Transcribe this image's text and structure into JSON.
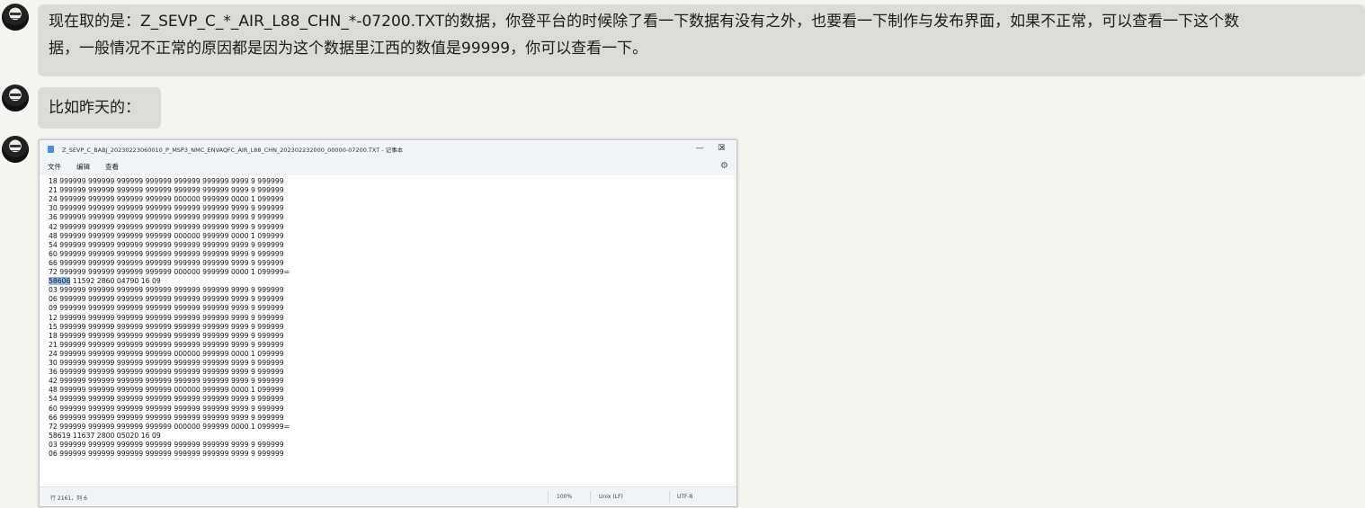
{
  "messages": [
    {
      "lines": [
        "现在取的是：Z_SEVP_C_*_AIR_L88_CHN_*-07200.TXT的数据，你登平台的时候除了看一下数据有没有之外，也要看一下制作与发布界面，如果不正常，可以查看一下这个数",
        "据，一般情况不正常的原因都是因为这个数据里江西的数值是99999，你可以查看一下。"
      ]
    },
    {
      "text": "比如昨天的："
    }
  ],
  "notepad": {
    "title": "Z_SEVP_C_BABJ_20230223060010_P_MSP3_NMC_ENVAQFC_AIR_L88_CHN_202302232000_00000-07200.TXT - 记事本",
    "minimize": "—",
    "maximize": "☐",
    "close": "✕",
    "menu": [
      "文件",
      "编辑",
      "查看"
    ],
    "settings_icon": "gear-icon",
    "lines": [
      "18 999999 999999 999999 999999 999999 999999 9999 9 999999",
      "21 999999 999999 999999 999999 999999 999999 9999 9 999999",
      "24 999999 999999 999999 999999 000000 999999 0000 1 099999",
      "30 999999 999999 999999 999999 999999 999999 9999 9 999999",
      "36 999999 999999 999999 999999 999999 999999 9999 9 999999",
      "42 999999 999999 999999 999999 999999 999999 9999 9 999999",
      "48 999999 999999 999999 999999 000000 999999 0000 1 099999",
      "54 999999 999999 999999 999999 999999 999999 9999 9 999999",
      "60 999999 999999 999999 999999 999999 999999 9999 9 999999",
      "66 999999 999999 999999 999999 999999 999999 9999 9 999999",
      "72 999999 999999 999999 999999 000000 999999 0000 1 099999=",
      "58606 11592 2860 04790 16 09",
      "03 999999 999999 999999 999999 999999 999999 9999 9 999999",
      "06 999999 999999 999999 999999 999999 999999 9999 9 999999",
      "09 999999 999999 999999 999999 999999 999999 9999 9 999999",
      "12 999999 999999 999999 999999 999999 999999 9999 9 999999",
      "15 999999 999999 999999 999999 999999 999999 9999 9 999999",
      "18 999999 999999 999999 999999 999999 999999 9999 9 999999",
      "21 999999 999999 999999 999999 999999 999999 9999 9 999999",
      "24 999999 999999 999999 999999 000000 999999 0000 1 099999",
      "30 999999 999999 999999 999999 999999 999999 9999 9 999999",
      "36 999999 999999 999999 999999 999999 999999 9999 9 999999",
      "42 999999 999999 999999 999999 999999 999999 9999 9 999999",
      "48 999999 999999 999999 999999 000000 999999 0000 1 099999",
      "54 999999 999999 999999 999999 999999 999999 9999 9 999999",
      "60 999999 999999 999999 999999 999999 999999 9999 9 999999",
      "66 999999 999999 999999 999999 999999 999999 9999 9 999999",
      "72 999999 999999 999999 999999 000000 999999 0000 1 099999=",
      "58619 11637 2800 05020 16 09",
      "03 999999 999999 999999 999999 999999 999999 9999 9 999999",
      "06 999999 999999 999999 999999 999999 999999 9999 9 999999"
    ],
    "selected_text": "58606",
    "selected_line_index": 11,
    "status": {
      "position": "行 2161，列 6",
      "zoom": "100%",
      "line_ending": "Unix (LF)",
      "encoding": "UTF-8"
    }
  },
  "colors": {
    "page_bg": "#f5f5f0",
    "bubble_bg": "#dcdcd7",
    "selection": "#9bc1ec"
  }
}
